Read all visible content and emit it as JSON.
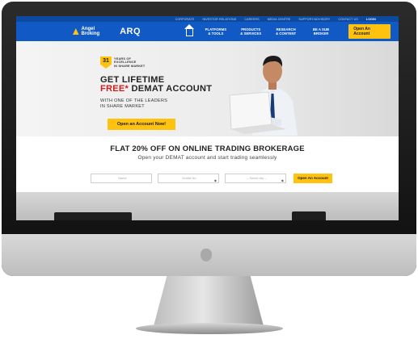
{
  "topbar": {
    "links": [
      "CORPORATE",
      "INVESTOR RELATIONS",
      "CAREERS",
      "MEDIA CENTRE",
      "SUPPORT/ADVISORY",
      "CONTACT US",
      "LOGIN"
    ]
  },
  "nav": {
    "brand": "Angel Broking",
    "product": "ARQ",
    "home_icon": "home-icon",
    "items": [
      {
        "line1": "PLATFORMS",
        "line2": "& TOOLS"
      },
      {
        "line1": "PRODUCTS",
        "line2": "& SERVICES"
      },
      {
        "line1": "RESEARCH",
        "line2": "& CONTENT"
      },
      {
        "line1": "BE A SUB",
        "line2": "BROKER"
      }
    ],
    "cta": "Open An Account"
  },
  "hero": {
    "badge_number": "31",
    "badge_line1": "YEARS OF",
    "badge_line2": "EXCELLENCE",
    "badge_line3": "IN SHARE MARKET",
    "heading_line1": "GET LIFETIME",
    "heading_free": "FREE*",
    "heading_rest": " DEMAT ACCOUNT",
    "sub_line1": "WITH ONE OF THE LEADERS",
    "sub_line2": "IN SHARE MARKET",
    "cta": "Open an Account Now!"
  },
  "offer": {
    "title": "FLAT 20% OFF ON ONLINE TRADING BROKERAGE",
    "subtitle": "Open your DEMAT account and start trading seamlessly",
    "name_placeholder": "Name",
    "mobile_placeholder": "Mobile No.",
    "city_placeholder": "-- Select city --",
    "cta": "Open An Account"
  },
  "colors": {
    "nav_blue": "#1159c5",
    "topbar_blue": "#0c4aa0",
    "accent_yellow": "#ffc20e",
    "free_red": "#d01c1c"
  }
}
